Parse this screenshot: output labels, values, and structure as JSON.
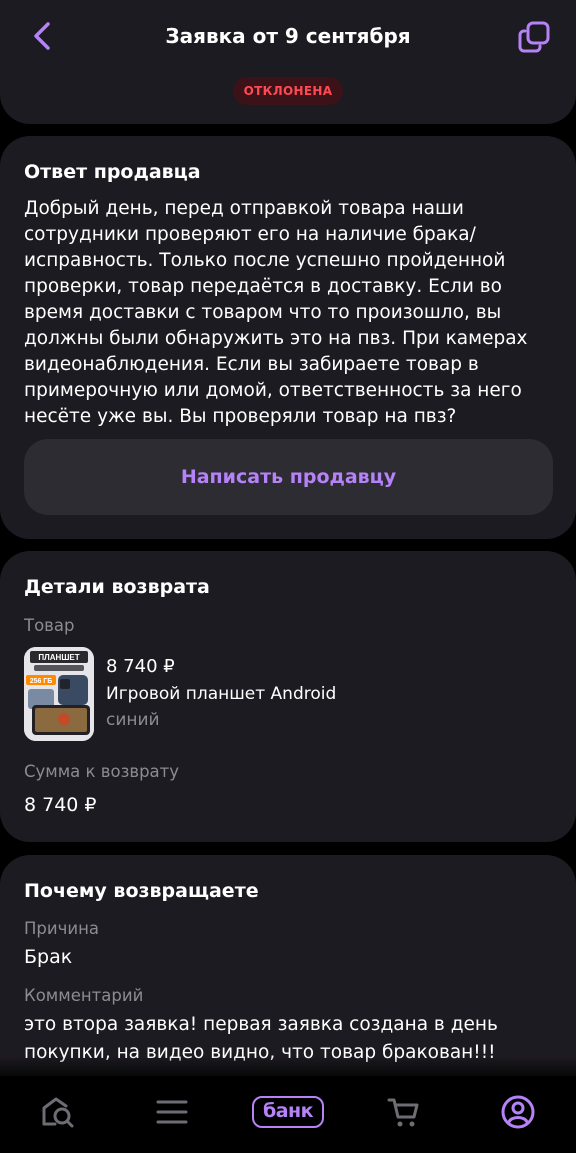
{
  "header": {
    "title": "Заявка от 9 сентября",
    "status": "ОТКЛОНЕНА",
    "back_icon": "chevron-left-icon",
    "copy_icon": "copy-icon"
  },
  "seller_reply": {
    "title": "Ответ продавца",
    "text": "Добрый день, перед отправкой товара наши сотрудники проверяют его на наличие брака/исправность. Только после успешно пройденной проверки, товар передаётся в доставку. Если во время доставки с товаром что то произошло, вы должны были обнаружить это на пвз. При камерах видеонаблюдения. Если вы забираете товар в примерочную или домой, ответственность за него несёте уже вы. Вы проверяли товар на пвз?",
    "button_label": "Написать продавцу"
  },
  "return_details": {
    "title": "Детали возврата",
    "product_label": "Товар",
    "product": {
      "price": "8 740 ₽",
      "name": "Игровой планшет Android",
      "color": "синий",
      "thumb_text_top": "ПЛАНШЕТ",
      "thumb_text_storage": "256 ГБ"
    },
    "refund_label": "Сумма к возврату",
    "refund_value": "8 740 ₽"
  },
  "return_reason": {
    "title": "Почему возвращаете",
    "reason_label": "Причина",
    "reason_value": "Брак",
    "comment_label": "Комментарий",
    "comment_text": "это втора заявка! первая заявка создана в день покупки, на видео видно, что товар бракован!!!"
  },
  "tabbar": {
    "items": [
      {
        "name": "home",
        "icon": "home-search-icon"
      },
      {
        "name": "catalog",
        "icon": "menu-icon"
      },
      {
        "name": "bank",
        "label": "банк"
      },
      {
        "name": "cart",
        "icon": "cart-icon"
      },
      {
        "name": "profile",
        "icon": "profile-icon"
      }
    ]
  },
  "colors": {
    "accent": "#b583f7",
    "card_bg": "#1c1b21",
    "status_red": "#ff4a55",
    "muted_text": "#8c8b92"
  }
}
